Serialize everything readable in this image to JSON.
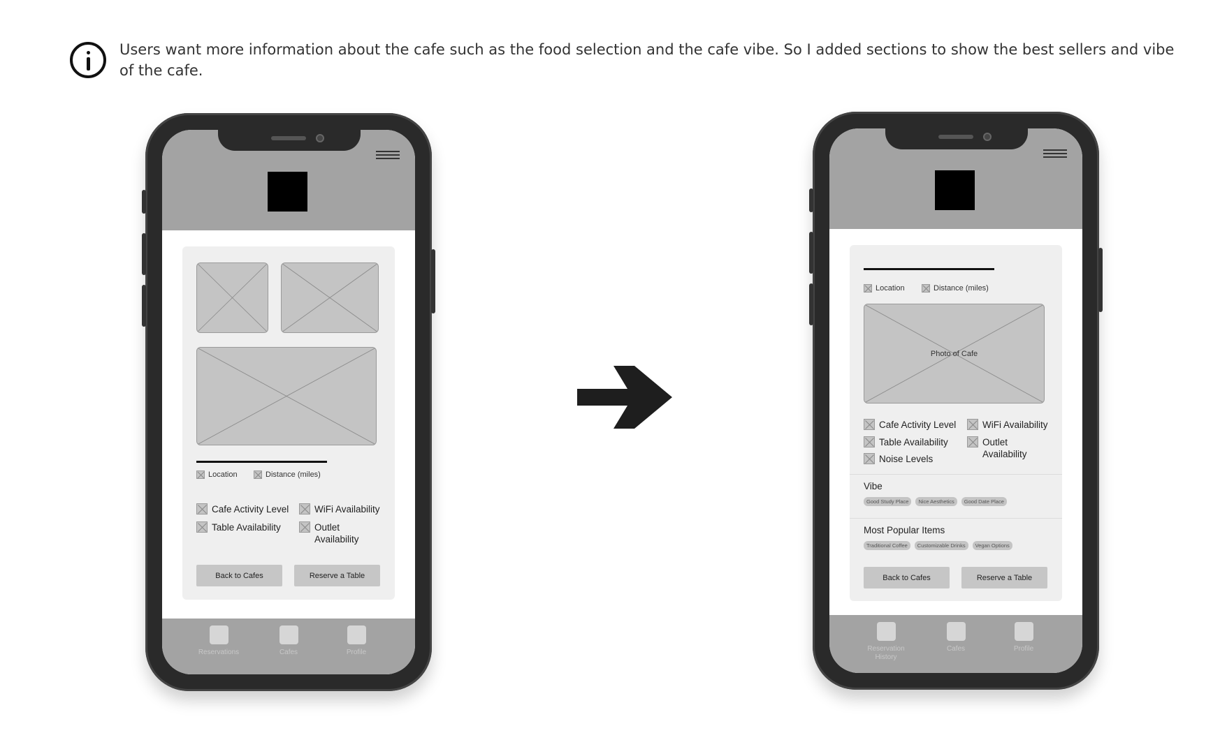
{
  "note": {
    "text": "Users want more information about the cafe such as the food selection and the cafe vibe. So I added sections to show the best sellers and vibe of the cafe."
  },
  "before": {
    "location": "Location",
    "distance": "Distance (miles)",
    "features": [
      "Cafe Activity Level",
      "WiFi Availability",
      "Table Availability",
      "Outlet Availability"
    ],
    "back_button": "Back to Cafes",
    "reserve_button": "Reserve a Table",
    "tabs": [
      "Reservations",
      "Cafes",
      "Profile"
    ]
  },
  "after": {
    "location": "Location",
    "distance": "Distance (miles)",
    "photo_label": "Photo of Cafe",
    "features": [
      "Cafe Activity Level",
      "WiFi Availability",
      "Table Availability",
      "Outlet Availability",
      "Noise Levels"
    ],
    "vibe_title": "Vibe",
    "vibe_chips": [
      "Good Study Place",
      "Nice Aesthetics",
      "Good Date Place"
    ],
    "popular_title": "Most Popular Items",
    "popular_chips": [
      "Traditional Coffee",
      "Customizable Drinks",
      "Vegan Options"
    ],
    "back_button": "Back to Cafes",
    "reserve_button": "Reserve a Table",
    "tabs": [
      "Reservation History",
      "Cafes",
      "Profile"
    ]
  },
  "icons": [
    "info-icon",
    "hamburger-menu-icon",
    "arrow-right-icon",
    "image-placeholder-icon"
  ]
}
